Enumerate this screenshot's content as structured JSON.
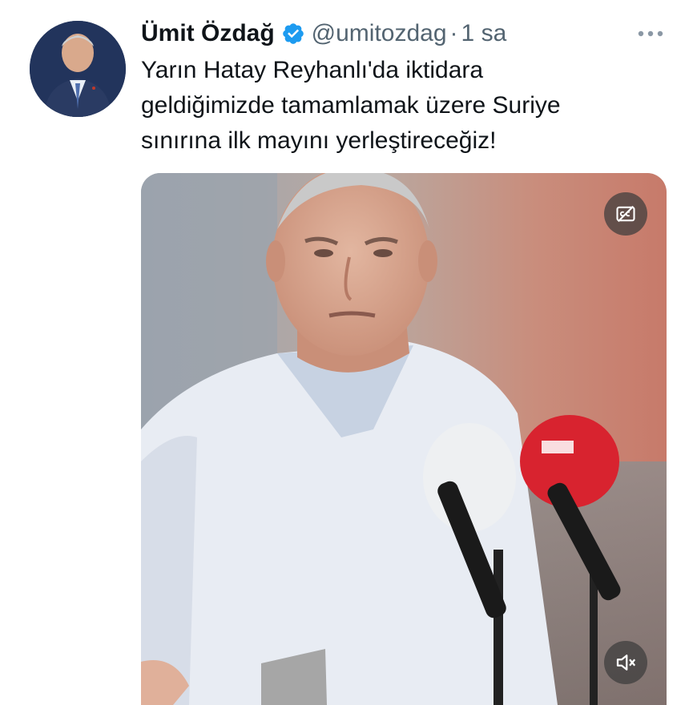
{
  "tweet": {
    "display_name": "Ümit Özdağ",
    "handle": "@umitozdag",
    "separator": "·",
    "time": "1 sa",
    "text": "Yarın Hatay Reyhanlı'da iktidara\ngeldiğimizde tamamlamak üzere Suriye\nsınırına ilk mayını yerleştireceğiz!"
  },
  "icons": {
    "verified": "verified-badge-icon",
    "more": "more-icon",
    "captions": "captions-off-icon",
    "mute": "muted-volume-icon"
  },
  "colors": {
    "verified": "#1d9bf0",
    "text": "#0f1419",
    "secondary": "#536471",
    "media_button_bg": "#3c3c3c"
  }
}
